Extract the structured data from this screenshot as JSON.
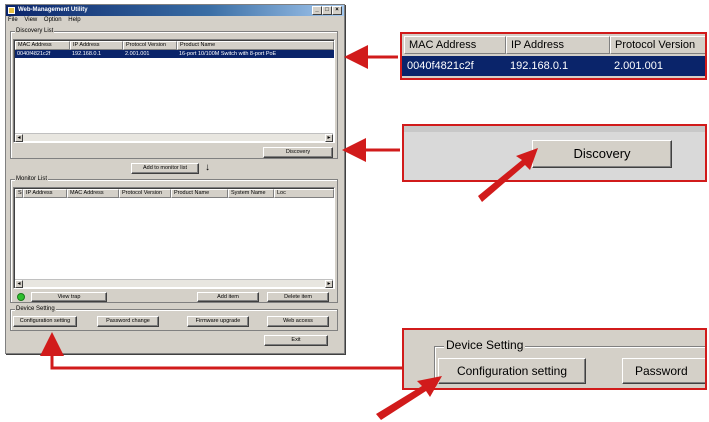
{
  "window": {
    "title": "Web-Management Utility",
    "menu": [
      "File",
      "View",
      "Option",
      "Help"
    ],
    "discovery_group": "Discovery List",
    "discovery_columns": [
      "MAC Address",
      "IP Address",
      "Protocol Version",
      "Product Name"
    ],
    "discovery_row": {
      "mac": "0040f4821c2f",
      "ip": "192.168.0.1",
      "protocol": "2.001.001",
      "product": "16-port 10/100M Switch with 8-port PoE"
    },
    "discovery_button": "Discovery",
    "add_monitor_button": "Add to monitor list",
    "monitor_group": "Monitor List",
    "monitor_columns": [
      "S",
      "IP Address",
      "MAC Address",
      "Protocol Version",
      "Product Name",
      "System Name",
      "Loc"
    ],
    "view_trap_button": "View trap",
    "add_item_button": "Add item",
    "delete_item_button": "Delete item",
    "device_group": "Device Setting",
    "config_button": "Configuration setting",
    "password_button": "Password change",
    "firmware_button": "Firmware upgrade",
    "web_access_button": "Web access",
    "exit_button": "Exit"
  },
  "zoom1": {
    "columns": [
      "MAC Address",
      "IP Address",
      "Protocol Version"
    ],
    "row": {
      "mac": "0040f4821c2f",
      "ip": "192.168.0.1",
      "protocol": "2.001.001"
    }
  },
  "zoom2": {
    "button": "Discovery"
  },
  "zoom3": {
    "group": "Device Setting",
    "config_button": "Configuration setting",
    "password_button": "Password"
  },
  "colors": {
    "arrow": "#d11b1b",
    "selection": "#0a246a",
    "status_led": "#2fbf2f"
  }
}
